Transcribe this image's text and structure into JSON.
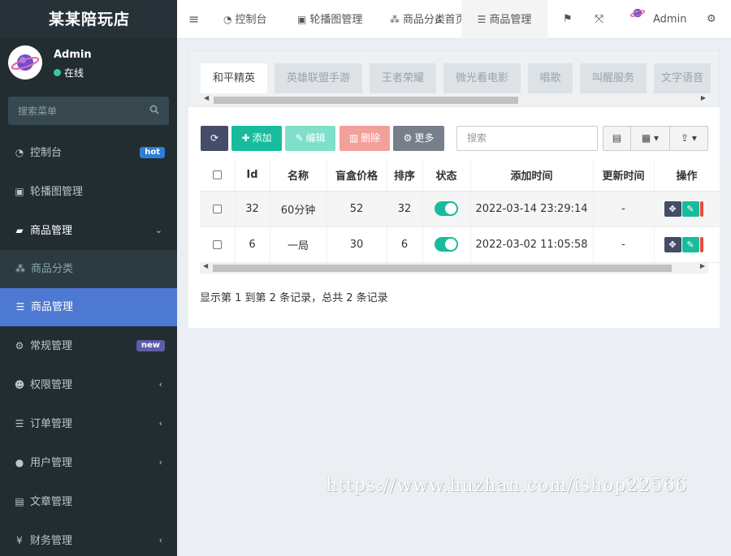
{
  "brand": {
    "title": "某某陪玩店"
  },
  "user": {
    "name": "Admin",
    "status": "在线"
  },
  "sidebar": {
    "search_placeholder": "搜索菜单",
    "items": [
      {
        "label": "控制台",
        "icon": "dashboard-icon",
        "badge": "hot"
      },
      {
        "label": "轮播图管理",
        "icon": "image-icon"
      },
      {
        "label": "商品管理",
        "icon": "book-icon",
        "expanded": true,
        "children": [
          {
            "label": "商品分类",
            "icon": "cubes-icon"
          },
          {
            "label": "商品管理",
            "icon": "list-icon",
            "active": true
          }
        ]
      },
      {
        "label": "常规管理",
        "icon": "cogs-icon",
        "badge": "new"
      },
      {
        "label": "权限管理",
        "icon": "group-icon"
      },
      {
        "label": "订单管理",
        "icon": "list-icon"
      },
      {
        "label": "用户管理",
        "icon": "user-icon"
      },
      {
        "label": "文章管理",
        "icon": "newspaper-icon"
      },
      {
        "label": "财务管理",
        "icon": "yen-icon"
      }
    ]
  },
  "topbar": {
    "tabs": [
      {
        "label": "控制台",
        "icon": "dashboard-icon"
      },
      {
        "label": "轮播图管理",
        "icon": "image-icon"
      },
      {
        "label": "商品分类",
        "icon": "cubes-icon"
      },
      {
        "label": "首页",
        "icon": "home-icon"
      },
      {
        "label": "商品管理",
        "icon": "list-icon",
        "active": true
      }
    ],
    "user": "Admin"
  },
  "category_tabs": [
    "和平精英",
    "英雄联盟手游",
    "王者荣耀",
    "微光看电影",
    "唱歌",
    "叫醒服务",
    "文字语音"
  ],
  "toolbar": {
    "add_label": "添加",
    "edit_label": "编辑",
    "delete_label": "删除",
    "more_label": "更多",
    "search_placeholder": "搜索"
  },
  "table": {
    "columns": [
      "Id",
      "名称",
      "盲盒价格",
      "排序",
      "状态",
      "添加时间",
      "更新时间",
      "操作"
    ],
    "rows": [
      {
        "id": "32",
        "name": "60分钟",
        "price": "52",
        "sort": "32",
        "status_on": true,
        "created": "2022-03-14 23:29:14",
        "updated": "-"
      },
      {
        "id": "6",
        "name": "一局",
        "price": "30",
        "sort": "6",
        "status_on": true,
        "created": "2022-03-02 11:05:58",
        "updated": "-"
      }
    ]
  },
  "summary": "显示第 1 到第 2 条记录，总共 2 条记录",
  "watermark": "https://www.huzhan.com/ishop22566",
  "colors": {
    "sidebar_bg": "#222d32",
    "active_menu": "#4e79d2",
    "refresh_btn": "#444c69",
    "add_btn": "#18bc9c",
    "edit_btn": "#7ee0ca",
    "delete_btn": "#f4a09a",
    "more_btn": "#777f8b"
  }
}
